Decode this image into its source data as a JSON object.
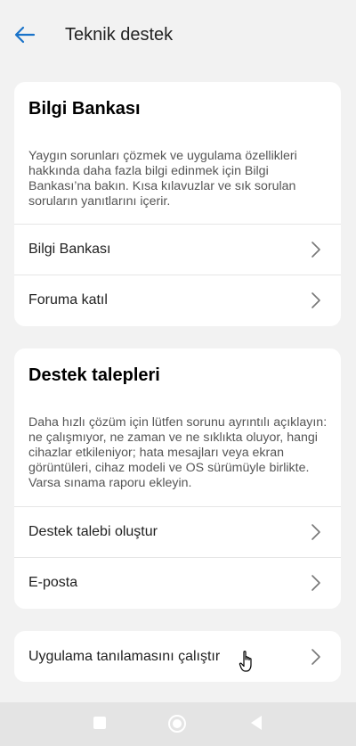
{
  "header": {
    "title": "Teknik destek",
    "back_icon": "arrow-left-icon",
    "accent_color": "#1a73c9"
  },
  "knowledge_card": {
    "title": "Bilgi Bankası",
    "description": "Yaygın sorunları çözmek ve uygulama özellikleri hakkında daha fazla bilgi edinmek için Bilgi Bankası’na bakın. Kısa kılavuzlar ve sık sorulan soruların yanıtlarını içerir.",
    "items": [
      {
        "label": "Bilgi Bankası",
        "icon": "chevron-right-icon"
      },
      {
        "label": "Foruma katıl",
        "icon": "chevron-right-icon"
      }
    ]
  },
  "support_card": {
    "title": "Destek talepleri",
    "description": "Daha hızlı çözüm için lütfen sorunu ayrıntılı açıklayın: ne çalışmıyor, ne zaman ve ne sıklıkta oluyor, hangi cihazlar etkileniyor; hata mesajları veya ekran görüntüleri, cihaz modeli ve OS sürümüyle birlikte. Varsa sınama raporu ekleyin.",
    "items": [
      {
        "label": "Destek talebi oluştur",
        "icon": "chevron-right-icon"
      },
      {
        "label": "E-posta",
        "icon": "chevron-right-icon"
      }
    ]
  },
  "diagnostics_card": {
    "items": [
      {
        "label": "Uygulama tanılamasını çalıştır",
        "icon": "chevron-right-icon"
      }
    ]
  },
  "cursor": {
    "icon": "hand-pointer-cursor-icon"
  },
  "navbar": {
    "recents_icon": "square-recents-icon",
    "home_icon": "circle-home-icon",
    "back_icon": "triangle-back-icon"
  }
}
